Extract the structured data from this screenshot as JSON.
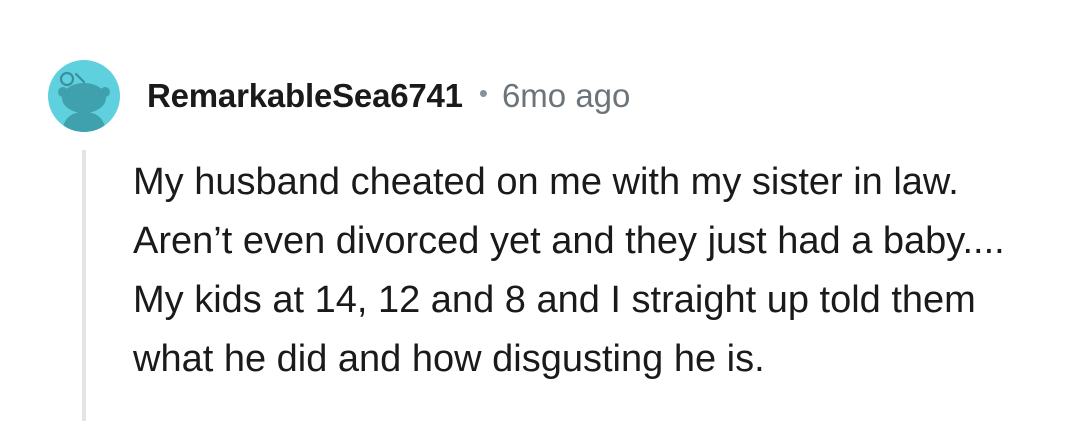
{
  "comment": {
    "avatar_icon": "reddit-snoo-avatar-icon",
    "avatar_color": "#5fd0dd",
    "username": "RemarkableSea6741",
    "separator": "•",
    "timestamp": "6mo ago",
    "body": "My husband cheated on me with my sister in law. Aren’t even divorced yet and they just had a baby.... My kids at 14, 12 and 8 and I straight up told them what he did and how disgusting he is."
  }
}
